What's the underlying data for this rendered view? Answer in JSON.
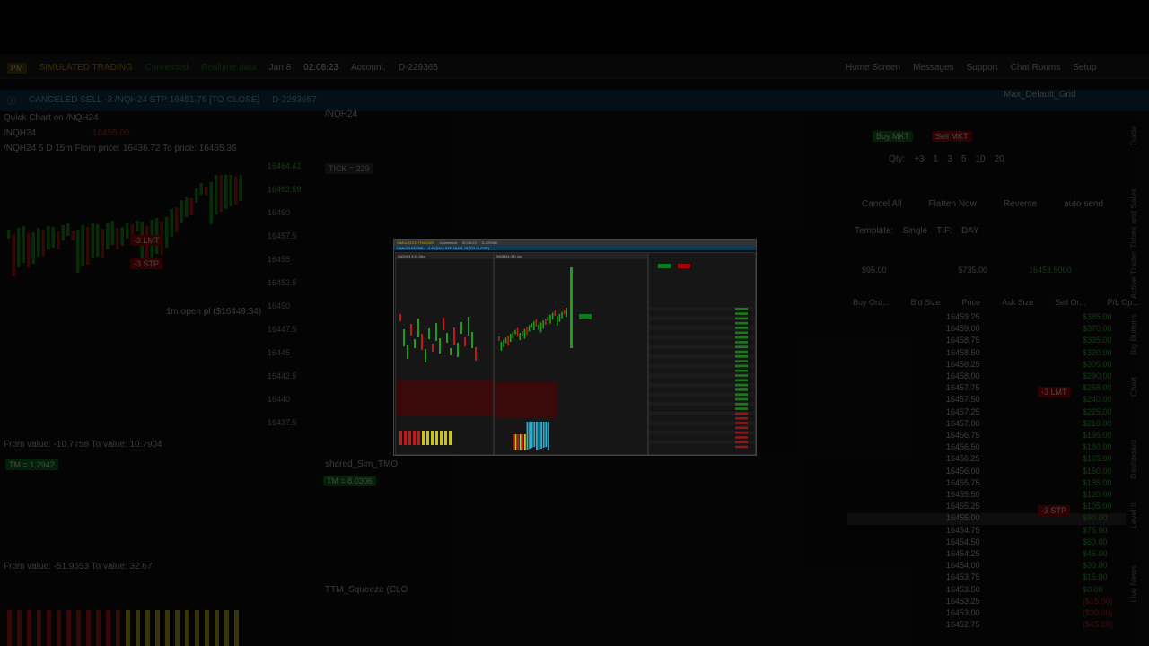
{
  "topbar": {
    "mode": "SIMULATED TRADING",
    "connection": "Connected",
    "data_status": "Realtime data",
    "date": "Jan 8",
    "time": "02:08:23",
    "account_label": "Account:",
    "account": "D-229365",
    "nav_items": [
      "Home Screen",
      "Messages",
      "Support",
      "Chat Rooms",
      "Setup"
    ]
  },
  "message": {
    "text": "CANCELED SELL -3 /NQH24 STP 16451.75 [TO CLOSE]",
    "ref": "D-2293657"
  },
  "quick_chart": {
    "title": "Quick Chart on /NQH24",
    "symbol": "/NQH24",
    "price": "16455.00",
    "chart_label": "/NQH24 5 D 15m",
    "from_price": "From price: 16436.72",
    "to_price": "To price: 16465.36",
    "lmt": "-3 LMT",
    "stp": "-3 STP",
    "open_pl": "1m open pl ($16449.34)"
  },
  "main_chart": {
    "symbol": "/NQH24",
    "chart_label": "/NQH24 3 D 1m",
    "tick": "TICK = 229",
    "study1": "shared_Sim_TMO",
    "tm1": "TM = 8.0306",
    "study2": "TTM_Squeeze (CLO",
    "tm_small": "TM = 1.2942",
    "from_value": "From value: -10.7758",
    "to_value": "To value: 10.7904",
    "from_value2": "From value: -51.9653",
    "to_value2": "To value: 32.67"
  },
  "right_panel": {
    "buy": "Buy MKT",
    "sell": "Sell MKT",
    "qty_label": "Qty:",
    "qty": "+3",
    "qty_buttons": [
      "1",
      "3",
      "5",
      "10",
      "20"
    ],
    "cancel_all": "Cancel All",
    "flatten": "Flatten Now",
    "reverse": "Reverse",
    "auto_send": "auto send",
    "template_label": "Template:",
    "template": "Single",
    "tif_label": "TIF:",
    "tif": "DAY",
    "layout": "Max_Default_Grid",
    "headers": [
      "Buy Ord...",
      "Bid Size",
      "Price",
      "Ask Size",
      "Sell Or...",
      "P/L Op..."
    ],
    "summary": {
      "left": "$95.00",
      "right": "$735.00",
      "top_price": "16453.5000",
      "pos": "+3"
    },
    "ladder": [
      {
        "price": "16459.25",
        "pl": "$385.00"
      },
      {
        "price": "16459.00",
        "pl": "$370.00"
      },
      {
        "price": "16458.75",
        "pl": "$335.00"
      },
      {
        "price": "16458.50",
        "pl": "$320.00"
      },
      {
        "price": "16458.25",
        "pl": "$305.00"
      },
      {
        "price": "16458.00",
        "pl": "$290.00"
      },
      {
        "price": "16457.75",
        "pl": "$255.00"
      },
      {
        "price": "16457.50",
        "pl": "$240.00"
      },
      {
        "price": "16457.25",
        "pl": "$225.00"
      },
      {
        "price": "16457.00",
        "pl": "$210.00"
      },
      {
        "price": "16456.75",
        "pl": "$195.00"
      },
      {
        "price": "16456.50",
        "pl": "$180.00"
      },
      {
        "price": "16456.25",
        "pl": "$165.00"
      },
      {
        "price": "16456.00",
        "pl": "$150.00"
      },
      {
        "price": "16455.75",
        "pl": "$135.00"
      },
      {
        "price": "16455.50",
        "pl": "$120.00"
      },
      {
        "price": "16455.25",
        "pl": "$105.00"
      },
      {
        "price": "16455.00",
        "pl": "$90.00"
      },
      {
        "price": "16454.75",
        "pl": "$75.00"
      },
      {
        "price": "16454.50",
        "pl": "$60.00"
      },
      {
        "price": "16454.25",
        "pl": "$45.00"
      },
      {
        "price": "16454.00",
        "pl": "$30.00"
      },
      {
        "price": "16453.75",
        "pl": "$15.00"
      },
      {
        "price": "16453.50",
        "pl": "$0.00"
      },
      {
        "price": "16453.25",
        "pl": "($15.00)"
      },
      {
        "price": "16453.00",
        "pl": "($30.00)"
      },
      {
        "price": "16452.75",
        "pl": "($45.00)"
      }
    ],
    "lmt_tag": "-3 LMT",
    "stp_tag": "-3 STP",
    "side_tabs": [
      "Trade",
      "Times and Sales",
      "Active Trader",
      "Big Buttons",
      "Chart",
      "Dashboard",
      "Level II",
      "Live News"
    ]
  },
  "price_scale": [
    "16464.41",
    "16462.59",
    "16460",
    "16457.5",
    "16455",
    "16452.5",
    "16450",
    "16447.5",
    "16445",
    "16442.5",
    "16440",
    "16437.5"
  ],
  "colors": {
    "accent_green": "#0a7a1a",
    "accent_red": "#aa0000",
    "bg": "#111111"
  }
}
